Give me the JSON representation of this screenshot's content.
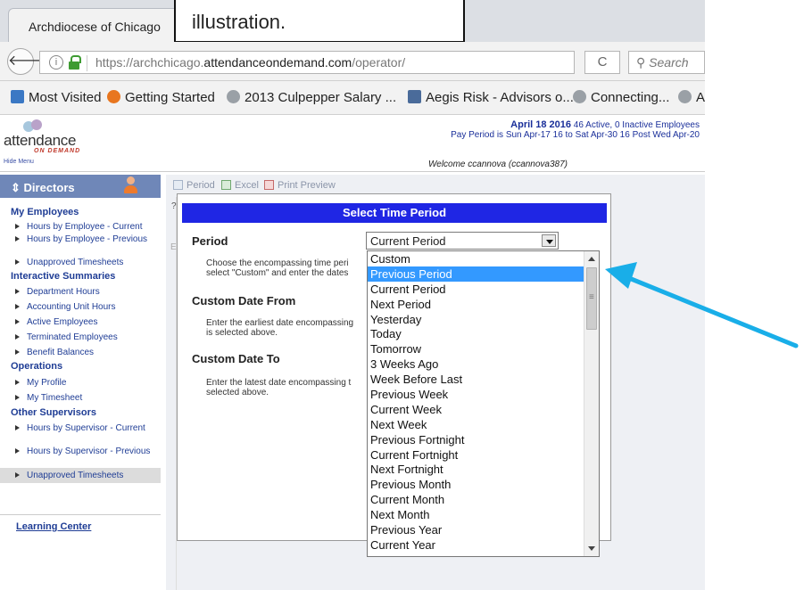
{
  "browser": {
    "tab_title": "Archdiocese of Chicago",
    "url_prefix": "https://archchicago.",
    "url_domain": "attendanceondemand.com",
    "url_path": "/operator/",
    "reload_icon": "reload-icon",
    "search_placeholder": "Search"
  },
  "bookmarks": [
    {
      "label": "Most Visited",
      "icon": "bookmark-star-icon",
      "color": "#3b78c4"
    },
    {
      "label": "Getting Started",
      "icon": "firefox-icon",
      "color": "#e8761f"
    },
    {
      "label": "2013 Culpepper Salary ...",
      "icon": "globe-icon",
      "color": "#9aa0a6"
    },
    {
      "label": "Aegis Risk - Advisors o...",
      "icon": "aegis-icon",
      "color": "#4a6b9a"
    },
    {
      "label": "Connecting...",
      "icon": "globe-icon",
      "color": "#9aa0a6"
    },
    {
      "label": "A",
      "icon": "globe-icon",
      "color": "#9aa0a6"
    }
  ],
  "callout": {
    "text": "illustration."
  },
  "app": {
    "logo_text": "attendance",
    "logo_sub": "ON DEMAND",
    "hide_menu": "Hide Menu",
    "date_bold": "April 18 2016",
    "date_rest": " 46 Active, 0 Inactive Employees",
    "pay_period": "Pay Period is Sun Apr-17 16 to Sat Apr-30 16 Post Wed Apr-20",
    "welcome": "Welcome ccannova (ccannova387)"
  },
  "sidebar": {
    "header": "Directors",
    "header_icon": "sort-arrows-icon",
    "sections": [
      {
        "title": "My Employees",
        "items": [
          "Hours by Employee - Current",
          "Hours by Employee - Previous",
          "Unapproved Timesheets"
        ]
      },
      {
        "title": "Interactive Summaries",
        "items": [
          "Department Hours",
          "Accounting Unit Hours",
          "Active Employees",
          "Terminated Employees",
          "Benefit Balances"
        ]
      },
      {
        "title": "Operations",
        "items": [
          "My Profile",
          "My Timesheet"
        ]
      },
      {
        "title": "Other Supervisors",
        "items": [
          "Hours by Supervisor - Current",
          "Hours by Supervisor - Previous",
          "Unapproved Timesheets"
        ]
      }
    ],
    "learning_center": "Learning Center"
  },
  "toolbar": {
    "period": "Period",
    "excel": "Excel",
    "print_preview": "Print Preview"
  },
  "dialog": {
    "title": "Select Time Period",
    "help_marker": "?",
    "period_label": "Period",
    "period_help_1": "Choose the encompassing time peri",
    "period_help_2": "select \"Custom\" and enter the dates",
    "from_label": "Custom Date From",
    "from_help_1": "Enter the earliest date encompassing",
    "from_help_2": "is selected above.",
    "to_label": "Custom Date To",
    "to_help_1": "Enter the latest date encompassing t",
    "to_help_2": "selected above.",
    "selected_value": "Current Period",
    "options": [
      "Custom",
      "Previous Period",
      "Current Period",
      "Next Period",
      "Yesterday",
      "Today",
      "Tomorrow",
      "3 Weeks Ago",
      "Week Before Last",
      "Previous Week",
      "Current Week",
      "Next Week",
      "Previous Fortnight",
      "Current Fortnight",
      "Next Fortnight",
      "Previous Month",
      "Current Month",
      "Next Month",
      "Previous Year",
      "Current Year"
    ],
    "highlighted_index": 1
  },
  "colors": {
    "arrow": "#19aee8",
    "dialog_title_bg": "#1f26e4",
    "highlight": "#3399ff"
  }
}
